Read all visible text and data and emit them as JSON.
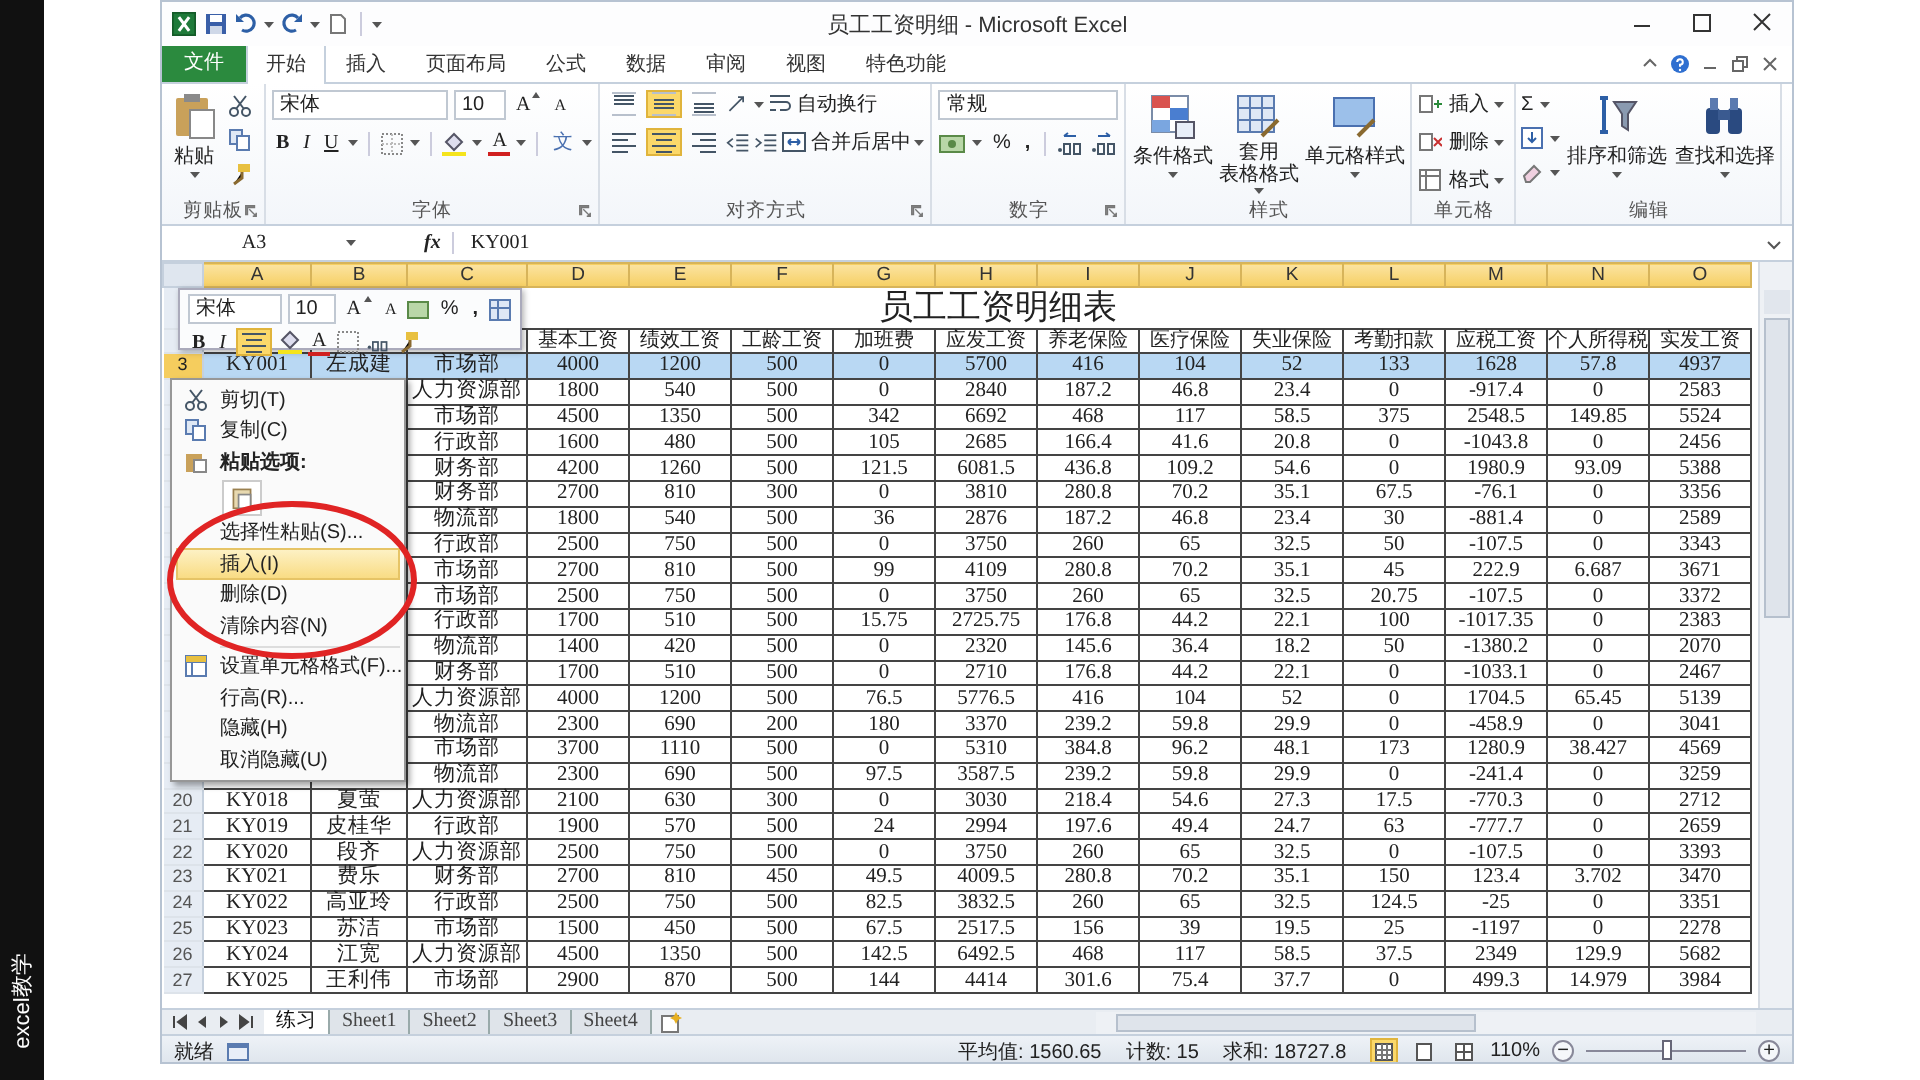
{
  "side_caption": "excel教学",
  "title_bar": {
    "title": "员工工资明细 - Microsoft Excel"
  },
  "ribbon_tabs": [
    {
      "label": "文件",
      "kind": "file",
      "selected": false
    },
    {
      "label": "开始",
      "kind": "tab",
      "selected": true
    },
    {
      "label": "插入",
      "kind": "tab",
      "selected": false
    },
    {
      "label": "页面布局",
      "kind": "tab",
      "selected": false
    },
    {
      "label": "公式",
      "kind": "tab",
      "selected": false
    },
    {
      "label": "数据",
      "kind": "tab",
      "selected": false
    },
    {
      "label": "审阅",
      "kind": "tab",
      "selected": false
    },
    {
      "label": "视图",
      "kind": "tab",
      "selected": false
    },
    {
      "label": "特色功能",
      "kind": "tab",
      "selected": false
    }
  ],
  "ribbon": {
    "clipboard": {
      "label": "剪贴板",
      "paste": "粘贴"
    },
    "font": {
      "label": "字体",
      "family": "宋体",
      "size": "10",
      "grow": "A",
      "shrink": "A",
      "bold": "B",
      "italic": "I",
      "underline": "U",
      "font_color": "A",
      "phonetic": "文"
    },
    "alignment": {
      "label": "对齐方式",
      "vertical": [
        {
          "selected": false
        },
        {
          "selected": true
        },
        {
          "selected": false
        }
      ],
      "horizontal": [
        {
          "selected": false
        },
        {
          "selected": true
        },
        {
          "selected": false
        }
      ],
      "wrap": "自动换行",
      "merge": "合并后居中"
    },
    "number": {
      "label": "数字",
      "format": "常规",
      "percent": "%",
      "comma": ","
    },
    "styles": {
      "label": "样式",
      "conditional": "条件格式",
      "table_lines": [
        "套用",
        "表格格式"
      ],
      "cell_styles": "单元格样式"
    },
    "cells": {
      "label": "单元格",
      "items": [
        "插入",
        "删除",
        "格式"
      ]
    },
    "editing": {
      "label": "编辑",
      "sum": "Σ",
      "sort": "排序和筛选",
      "find": "查找和选择"
    }
  },
  "formula_bar": {
    "name_box": "A3",
    "fx": "fx",
    "value": "KY001"
  },
  "sheet": {
    "columns": [
      "A",
      "B",
      "C",
      "D",
      "E",
      "F",
      "G",
      "H",
      "I",
      "J",
      "K",
      "L",
      "M",
      "N",
      "O"
    ],
    "title": "员工工资明细表",
    "headers": [
      "基本工资",
      "绩效工资",
      "工龄工资",
      "加班费",
      "应发工资",
      "养老保险",
      "医疗保险",
      "失业保险",
      "考勤扣款",
      "应税工资",
      "个人所得税",
      "实发工资"
    ],
    "rows": [
      {
        "number": "3",
        "selected": true,
        "cells": [
          "KY001",
          "左成建",
          "市场部",
          "4000",
          "1200",
          "500",
          "0",
          "5700",
          "416",
          "104",
          "52",
          "133",
          "1628",
          "57.8",
          "4937"
        ]
      },
      {
        "selected": false,
        "cells": [
          null,
          null,
          "人力资源部",
          "1800",
          "540",
          "500",
          "0",
          "2840",
          "187.2",
          "46.8",
          "23.4",
          "0",
          "-917.4",
          "0",
          "2583"
        ]
      },
      {
        "selected": false,
        "cells": [
          null,
          null,
          "市场部",
          "4500",
          "1350",
          "500",
          "342",
          "6692",
          "468",
          "117",
          "58.5",
          "375",
          "2548.5",
          "149.85",
          "5524"
        ]
      },
      {
        "selected": false,
        "cells": [
          null,
          null,
          "行政部",
          "1600",
          "480",
          "500",
          "105",
          "2685",
          "166.4",
          "41.6",
          "20.8",
          "0",
          "-1043.8",
          "0",
          "2456"
        ]
      },
      {
        "selected": false,
        "cells": [
          null,
          null,
          "财务部",
          "4200",
          "1260",
          "500",
          "121.5",
          "6081.5",
          "436.8",
          "109.2",
          "54.6",
          "0",
          "1980.9",
          "93.09",
          "5388"
        ]
      },
      {
        "selected": false,
        "cells": [
          null,
          null,
          "财务部",
          "2700",
          "810",
          "300",
          "0",
          "3810",
          "280.8",
          "70.2",
          "35.1",
          "67.5",
          "-76.1",
          "0",
          "3356"
        ]
      },
      {
        "selected": false,
        "cells": [
          null,
          null,
          "物流部",
          "1800",
          "540",
          "500",
          "36",
          "2876",
          "187.2",
          "46.8",
          "23.4",
          "30",
          "-881.4",
          "0",
          "2589"
        ]
      },
      {
        "selected": false,
        "cells": [
          null,
          null,
          "行政部",
          "2500",
          "750",
          "500",
          "0",
          "3750",
          "260",
          "65",
          "32.5",
          "50",
          "-107.5",
          "0",
          "3343"
        ]
      },
      {
        "selected": false,
        "cells": [
          null,
          null,
          "市场部",
          "2700",
          "810",
          "500",
          "99",
          "4109",
          "280.8",
          "70.2",
          "35.1",
          "45",
          "222.9",
          "6.687",
          "3671"
        ]
      },
      {
        "selected": false,
        "cells": [
          null,
          null,
          "市场部",
          "2500",
          "750",
          "500",
          "0",
          "3750",
          "260",
          "65",
          "32.5",
          "20.75",
          "-107.5",
          "0",
          "3372"
        ]
      },
      {
        "selected": false,
        "cells": [
          null,
          null,
          "行政部",
          "1700",
          "510",
          "500",
          "15.75",
          "2725.75",
          "176.8",
          "44.2",
          "22.1",
          "100",
          "-1017.35",
          "0",
          "2383"
        ]
      },
      {
        "selected": false,
        "cells": [
          null,
          null,
          "物流部",
          "1400",
          "420",
          "500",
          "0",
          "2320",
          "145.6",
          "36.4",
          "18.2",
          "50",
          "-1380.2",
          "0",
          "2070"
        ]
      },
      {
        "selected": false,
        "cells": [
          null,
          null,
          "财务部",
          "1700",
          "510",
          "500",
          "0",
          "2710",
          "176.8",
          "44.2",
          "22.1",
          "0",
          "-1033.1",
          "0",
          "2467"
        ]
      },
      {
        "selected": false,
        "cells": [
          null,
          null,
          "人力资源部",
          "4000",
          "1200",
          "500",
          "76.5",
          "5776.5",
          "416",
          "104",
          "52",
          "0",
          "1704.5",
          "65.45",
          "5139"
        ]
      },
      {
        "selected": false,
        "cells": [
          null,
          null,
          "物流部",
          "2300",
          "690",
          "200",
          "180",
          "3370",
          "239.2",
          "59.8",
          "29.9",
          "0",
          "-458.9",
          "0",
          "3041"
        ]
      },
      {
        "selected": false,
        "cells": [
          null,
          null,
          "市场部",
          "3700",
          "1110",
          "500",
          "0",
          "5310",
          "384.8",
          "96.2",
          "48.1",
          "173",
          "1280.9",
          "38.427",
          "4569"
        ]
      },
      {
        "selected": false,
        "cells": [
          null,
          null,
          "物流部",
          "2300",
          "690",
          "500",
          "97.5",
          "3587.5",
          "239.2",
          "59.8",
          "29.9",
          "0",
          "-241.4",
          "0",
          "3259"
        ]
      },
      {
        "number": "20",
        "selected": false,
        "cells": [
          "KY018",
          "夏萤",
          "人力资源部",
          "2100",
          "630",
          "300",
          "0",
          "3030",
          "218.4",
          "54.6",
          "27.3",
          "17.5",
          "-770.3",
          "0",
          "2712"
        ]
      },
      {
        "number": "21",
        "selected": false,
        "cells": [
          "KY019",
          "皮桂华",
          "行政部",
          "1900",
          "570",
          "500",
          "24",
          "2994",
          "197.6",
          "49.4",
          "24.7",
          "63",
          "-777.7",
          "0",
          "2659"
        ]
      },
      {
        "number": "22",
        "selected": false,
        "cells": [
          "KY020",
          "段齐",
          "人力资源部",
          "2500",
          "750",
          "500",
          "0",
          "3750",
          "260",
          "65",
          "32.5",
          "0",
          "-107.5",
          "0",
          "3393"
        ]
      },
      {
        "number": "23",
        "selected": false,
        "cells": [
          "KY021",
          "费乐",
          "财务部",
          "2700",
          "810",
          "450",
          "49.5",
          "4009.5",
          "280.8",
          "70.2",
          "35.1",
          "150",
          "123.4",
          "3.702",
          "3470"
        ]
      },
      {
        "number": "24",
        "selected": false,
        "cells": [
          "KY022",
          "高亚玲",
          "行政部",
          "2500",
          "750",
          "500",
          "82.5",
          "3832.5",
          "260",
          "65",
          "32.5",
          "124.5",
          "-25",
          "0",
          "3351"
        ]
      },
      {
        "number": "25",
        "selected": false,
        "cells": [
          "KY023",
          "苏洁",
          "市场部",
          "1500",
          "450",
          "500",
          "67.5",
          "2517.5",
          "156",
          "39",
          "19.5",
          "25",
          "-1197",
          "0",
          "2278"
        ]
      },
      {
        "number": "26",
        "selected": false,
        "cells": [
          "KY024",
          "江宽",
          "人力资源部",
          "4500",
          "1350",
          "500",
          "142.5",
          "6492.5",
          "468",
          "117",
          "58.5",
          "37.5",
          "2349",
          "129.9",
          "5682"
        ]
      },
      {
        "number": "27",
        "selected": false,
        "cells": [
          "KY025",
          "王利伟",
          "市场部",
          "2900",
          "870",
          "500",
          "144",
          "4414",
          "301.6",
          "75.4",
          "37.7",
          "0",
          "499.3",
          "14.979",
          "3984"
        ]
      }
    ]
  },
  "mini_toolbar": {
    "family": "宋体",
    "size": "10",
    "grow": "A",
    "shrink": "A",
    "percent": "%",
    "comma": ",",
    "bold": "B",
    "italic": "I",
    "center_align": {
      "selected": true
    },
    "font_color": "A"
  },
  "context_menu": {
    "items": [
      {
        "kind": "cut",
        "label": "剪切(T)",
        "selected": false
      },
      {
        "kind": "copy",
        "label": "复制(C)",
        "selected": false
      },
      {
        "kind": "paste-header",
        "label": "粘贴选项:",
        "selected": false
      },
      {
        "kind": "paste-option"
      },
      {
        "kind": "item",
        "label": "选择性粘贴(S)...",
        "selected": false
      },
      {
        "kind": "item",
        "label": "插入(I)",
        "selected": true
      },
      {
        "kind": "item",
        "label": "删除(D)",
        "selected": false
      },
      {
        "kind": "item",
        "label": "清除内容(N)",
        "selected": false
      },
      {
        "kind": "separator"
      },
      {
        "kind": "format",
        "label": "设置单元格格式(F)...",
        "selected": false
      },
      {
        "kind": "item",
        "label": "行高(R)...",
        "selected": false
      },
      {
        "kind": "item",
        "label": "隐藏(H)",
        "selected": false
      },
      {
        "kind": "item",
        "label": "取消隐藏(U)",
        "selected": false
      }
    ]
  },
  "annotations": [
    {
      "kind": "ellipse"
    }
  ],
  "sheet_tabs": [
    {
      "label": "练习",
      "selected": true
    },
    {
      "label": "Sheet1",
      "selected": false
    },
    {
      "label": "Sheet2",
      "selected": false
    },
    {
      "label": "Sheet3",
      "selected": false
    },
    {
      "label": "Sheet4",
      "selected": false
    }
  ],
  "status_bar": {
    "mode": "就绪",
    "stats": [
      "平均值: 1560.65",
      "计数: 15",
      "求和: 18727.8"
    ],
    "views": [
      {
        "selected": true
      },
      {
        "selected": false
      },
      {
        "selected": false
      }
    ],
    "zoom": "110%",
    "zoom_out": "−",
    "zoom_in": "+",
    "zoom_slider": {
      "level": 0.5
    }
  }
}
